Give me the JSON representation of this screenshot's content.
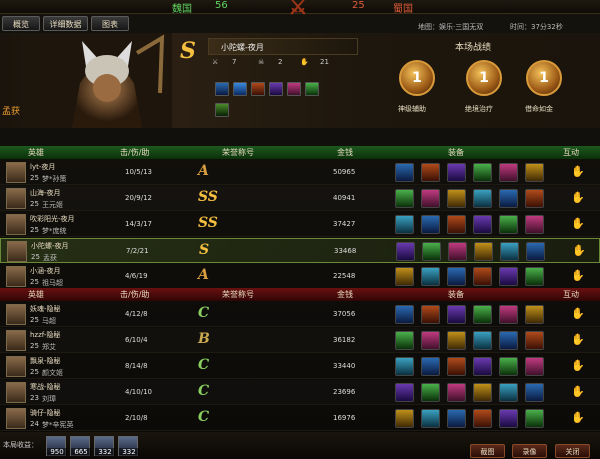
{
  "window": {
    "title": "孟获"
  },
  "tabs": [
    "概览",
    "详细数据",
    "图表"
  ],
  "score": {
    "wei_label": "魏国",
    "wei": "56",
    "shu": "25",
    "shu_label": "蜀国"
  },
  "map_info": "地图：娱乐·三国无双",
  "time_info": "时间：37分32秒",
  "hero": {
    "name": "孟获",
    "player": "小陀螺-夜月",
    "grade": "S",
    "kills": "7",
    "deaths": "2",
    "assists": "21"
  },
  "honor": {
    "title": "本场战绩",
    "medals": [
      {
        "n": "1",
        "label": "神级辅助"
      },
      {
        "n": "1",
        "label": "绝境治疗"
      },
      {
        "n": "1",
        "label": "借命如金"
      }
    ]
  },
  "table_headers": {
    "hero": "英雄",
    "kda": "击/伤/助",
    "honor": "荣誉称号",
    "gold": "金钱",
    "equip": "装备",
    "interact": "互动"
  },
  "wei_rows": [
    {
      "player": "lyt-夜月",
      "level": "25",
      "hero": "梦*孙策",
      "kda": "10/5/13",
      "title": "A",
      "gold": "50965"
    },
    {
      "player": "山海-夜月",
      "level": "25",
      "hero": "王元姬",
      "kda": "20/9/12",
      "title": "SS",
      "gold": "40941"
    },
    {
      "player": "吹彩阳光-夜月",
      "level": "25",
      "hero": "梦*庞统",
      "kda": "14/3/17",
      "title": "SS",
      "gold": "37427"
    },
    {
      "player": "小陀螺-夜月",
      "level": "25",
      "hero": "孟获",
      "kda": "7/2/21",
      "title": "S",
      "gold": "33468"
    },
    {
      "player": "小涵-夜月",
      "level": "25",
      "hero": "祖马超",
      "kda": "4/6/19",
      "title": "A",
      "gold": "22548"
    }
  ],
  "shu_rows": [
    {
      "player": "妖魂-隐秘",
      "level": "25",
      "hero": "马超",
      "kda": "4/12/8",
      "title": "C",
      "gold": "37056"
    },
    {
      "player": "hzzf-隐秘",
      "level": "25",
      "hero": "郑艾",
      "kda": "6/10/4",
      "title": "B",
      "gold": "36182"
    },
    {
      "player": "飘泉-隐秘",
      "level": "25",
      "hero": "颜文姬",
      "kda": "8/14/8",
      "title": "C",
      "gold": "33440"
    },
    {
      "player": "寒战-隐秘",
      "level": "23",
      "hero": "刘璋",
      "kda": "4/10/10",
      "title": "C",
      "gold": "23696"
    },
    {
      "player": "骑仔-隐秘",
      "level": "24",
      "hero": "梦*辛宪英",
      "kda": "2/10/8",
      "title": "C",
      "gold": "16976"
    }
  ],
  "bottom": {
    "earn_label": "本局收益：",
    "earnings": [
      "950",
      "665",
      "332",
      "332"
    ],
    "btn_screenshot": "截图",
    "btn_record": "录像",
    "btn_close": "关闭"
  }
}
